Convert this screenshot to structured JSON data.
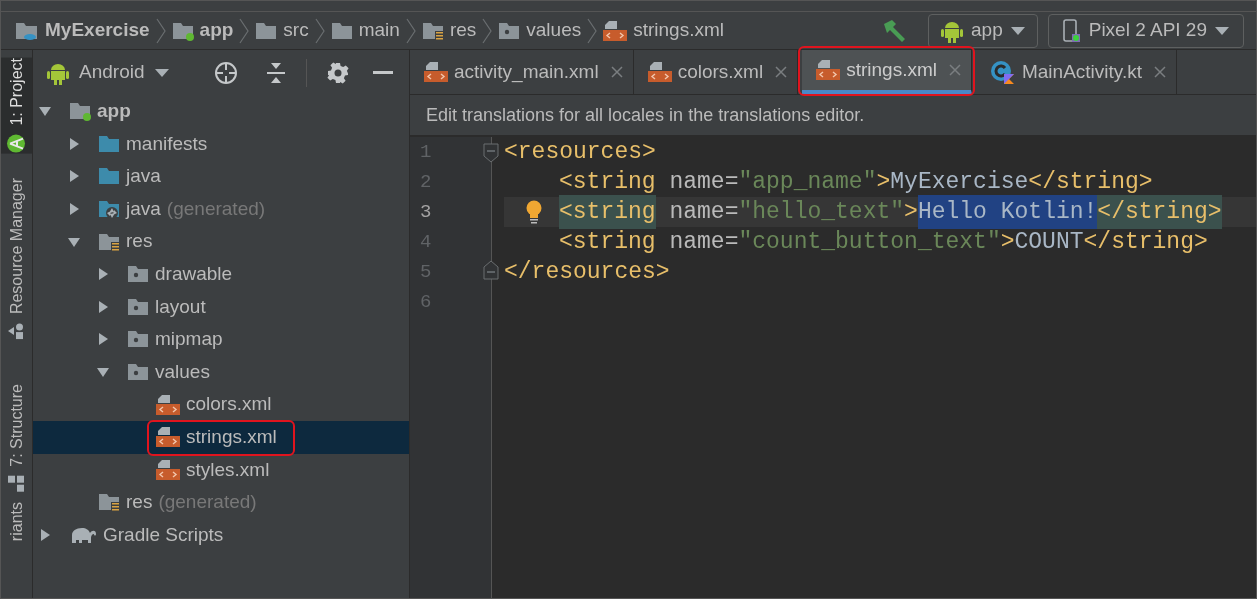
{
  "breadcrumbs": [
    {
      "label": "MyExercise",
      "kind": "project",
      "bold": true
    },
    {
      "label": "app",
      "kind": "module",
      "bold": true
    },
    {
      "label": "src",
      "kind": "folder",
      "bold": false
    },
    {
      "label": "main",
      "kind": "folder",
      "bold": false
    },
    {
      "label": "res",
      "kind": "resources",
      "bold": false
    },
    {
      "label": "values",
      "kind": "folder-res",
      "bold": false
    },
    {
      "label": "strings.xml",
      "kind": "xml",
      "bold": false
    }
  ],
  "toolbar": {
    "run_config": "app",
    "device": "Pixel 2 API 29"
  },
  "side_tabs": [
    {
      "label": "1: Project",
      "kind": "studio",
      "selected": true
    },
    {
      "label": "Resource Manager",
      "kind": "shapes",
      "selected": false
    },
    {
      "label": "7: Structure",
      "kind": "structure",
      "selected": false
    },
    {
      "label": "riants",
      "kind": "plain",
      "selected": false
    }
  ],
  "project_panel": {
    "view": "Android",
    "tree": [
      {
        "label": "app",
        "kind": "module",
        "bold": true,
        "expanded": true,
        "selected": false,
        "circled": false,
        "children": [
          {
            "label": "manifests",
            "kind": "folder",
            "bold": false,
            "expanded": false,
            "selected": false,
            "circled": false
          },
          {
            "label": "java",
            "kind": "folder",
            "bold": false,
            "expanded": false,
            "selected": false,
            "circled": false
          },
          {
            "label": "java",
            "suffix": "(generated)",
            "kind": "folder-generated",
            "bold": false,
            "expanded": false,
            "selected": false,
            "circled": false
          },
          {
            "label": "res",
            "kind": "resources",
            "bold": false,
            "expanded": true,
            "selected": false,
            "circled": false,
            "children": [
              {
                "label": "drawable",
                "kind": "folder-res",
                "bold": false,
                "expanded": false,
                "selected": false,
                "circled": false
              },
              {
                "label": "layout",
                "kind": "folder-res",
                "bold": false,
                "expanded": false,
                "selected": false,
                "circled": false
              },
              {
                "label": "mipmap",
                "kind": "folder-res",
                "bold": false,
                "expanded": false,
                "selected": false,
                "circled": false
              },
              {
                "label": "values",
                "kind": "folder-res",
                "bold": false,
                "expanded": true,
                "selected": false,
                "circled": false,
                "children": [
                  {
                    "label": "colors.xml",
                    "kind": "xml",
                    "bold": false,
                    "selected": false,
                    "circled": false
                  },
                  {
                    "label": "strings.xml",
                    "kind": "xml",
                    "bold": false,
                    "selected": true,
                    "circled": true
                  },
                  {
                    "label": "styles.xml",
                    "kind": "xml",
                    "bold": false,
                    "selected": false,
                    "circled": false
                  }
                ]
              }
            ]
          },
          {
            "label": "res",
            "suffix": "(generated)",
            "kind": "resources",
            "bold": false,
            "selected": false,
            "circled": false
          }
        ]
      },
      {
        "label": "Gradle Scripts",
        "kind": "gradle",
        "bold": false,
        "expanded": false,
        "selected": false,
        "circled": false
      }
    ]
  },
  "editor": {
    "tabs": [
      {
        "label": "activity_main.xml",
        "kind": "xml",
        "selected": false,
        "circled": false
      },
      {
        "label": "colors.xml",
        "kind": "xml",
        "selected": false,
        "circled": false
      },
      {
        "label": "strings.xml",
        "kind": "xml",
        "selected": true,
        "circled": true
      },
      {
        "label": "MainActivity.kt",
        "kind": "kotlin",
        "selected": false,
        "circled": false
      }
    ],
    "banner": "Edit translations for all locales in the translations editor.",
    "lines": [
      {
        "number": "1",
        "kind": "fold-start",
        "indented": false,
        "current": false,
        "bulb": false,
        "tokens": [
          {
            "text": "<resources>",
            "kind": "tag"
          }
        ]
      },
      {
        "number": "2",
        "kind": "plain",
        "indented": true,
        "current": false,
        "bulb": false,
        "tokens": [
          {
            "text": "<string",
            "kind": "tag"
          },
          {
            "text": " name=",
            "kind": "attr"
          },
          {
            "text": "\"app_name\"",
            "kind": "value"
          },
          {
            "text": ">",
            "kind": "tag"
          },
          {
            "text": "MyExercise",
            "kind": "text"
          },
          {
            "text": "</string>",
            "kind": "tag"
          }
        ]
      },
      {
        "number": "3",
        "kind": "plain",
        "indented": true,
        "current": true,
        "bulb": true,
        "tokens": [
          {
            "text": "<string",
            "kind": "tag-matched"
          },
          {
            "text": " name=",
            "kind": "attr"
          },
          {
            "text": "\"hello_text\"",
            "kind": "value"
          },
          {
            "text": ">",
            "kind": "tag"
          },
          {
            "text": "Hello Kotlin!",
            "kind": "text-selected"
          },
          {
            "text": "</string>",
            "kind": "tag-matched"
          }
        ]
      },
      {
        "number": "4",
        "kind": "plain",
        "indented": true,
        "current": false,
        "bulb": false,
        "tokens": [
          {
            "text": "<string",
            "kind": "tag"
          },
          {
            "text": " name=",
            "kind": "attr"
          },
          {
            "text": "\"count_button_text\"",
            "kind": "value"
          },
          {
            "text": ">",
            "kind": "tag"
          },
          {
            "text": "COUNT",
            "kind": "text"
          },
          {
            "text": "</string>",
            "kind": "tag"
          }
        ]
      },
      {
        "number": "5",
        "kind": "fold-end",
        "indented": false,
        "current": false,
        "bulb": false,
        "tokens": [
          {
            "text": "</resources>",
            "kind": "tag"
          }
        ]
      },
      {
        "number": "6",
        "kind": "plain",
        "current": false,
        "bulb": false
      }
    ]
  }
}
